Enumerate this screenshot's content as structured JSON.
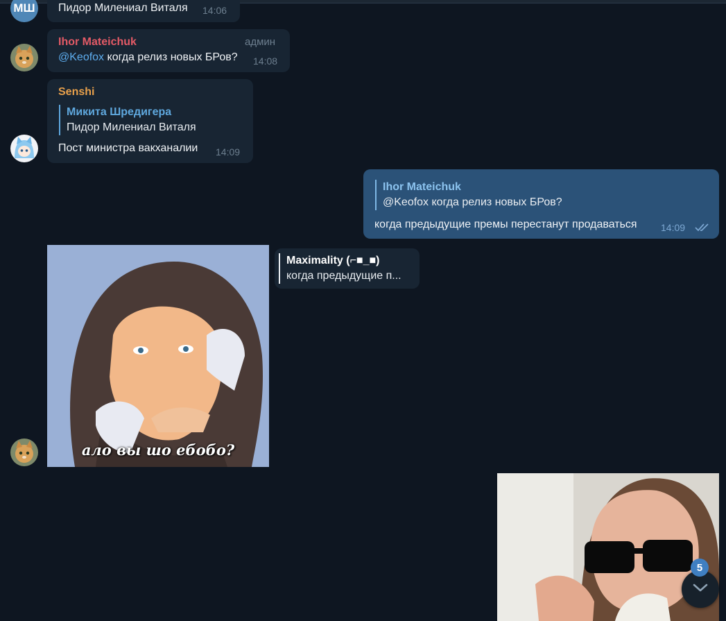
{
  "colors": {
    "background": "#0e1621",
    "bubble_in": "#182533",
    "bubble_out": "#2b5278",
    "sender_ihor": "#e35a66",
    "sender_senshi": "#e8a04b",
    "link": "#5eaef0",
    "badge": "#3f7fc2"
  },
  "messages": {
    "m1": {
      "avatar_initials": "МШ",
      "text": "Пидор Милениал Виталя",
      "time": "14:06"
    },
    "m2": {
      "sender": "Ihor Mateichuk",
      "role": "админ",
      "mention": "@Keofox",
      "text": " когда релиз новых БРов?",
      "time": "14:08"
    },
    "m3": {
      "sender": "Senshi",
      "reply_name": "Микита Шредигера",
      "reply_text": "Пидор Милениал Виталя",
      "text": "Пост министра вакханалии",
      "time": "14:09"
    },
    "m4": {
      "reply_name": "Ihor Mateichuk",
      "reply_text": "@Keofox когда релиз новых БРов?",
      "text": "когда предыдущие премы перестанут продаваться",
      "time": "14:09",
      "status_icon": "double-check-icon"
    },
    "m5": {
      "sticker_caption": "ало вы шо ебобо?",
      "reply_name": "Maximality (⌐■_■)",
      "reply_text": "когда предыдущие п..."
    }
  },
  "scroll": {
    "unread_count": "5",
    "icon": "chevron-down-icon"
  }
}
